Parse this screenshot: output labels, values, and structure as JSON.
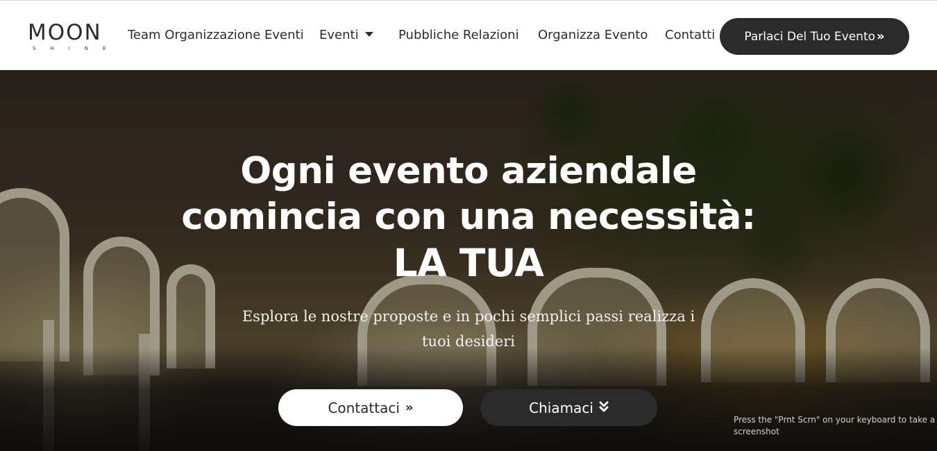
{
  "logo": {
    "main": "MOON",
    "sub": "SHINE"
  },
  "nav": {
    "items": [
      {
        "label": "Team Organizzazione Eventi"
      },
      {
        "label": "Eventi"
      },
      {
        "label": "Pubbliche Relazioni"
      },
      {
        "label": "Organizza Evento"
      },
      {
        "label": "Contatti"
      }
    ],
    "cta_label": "Parlaci Del Tuo Evento",
    "cta_icon": "double-chevron-right-icon"
  },
  "hero": {
    "title_line1": "Ogni evento aziendale",
    "title_line2": "comincia con una necessità:",
    "title_line3": "LA TUA",
    "subtitle": "Esplora le nostre proposte e in pochi semplici passi realizza i tuoi desideri",
    "btn_contact": "Contattaci",
    "btn_contact_icon": "double-chevron-right-icon",
    "btn_call": "Chiamaci",
    "btn_call_icon": "double-chevron-down-icon"
  },
  "toast": {
    "text": "Press the \"Prnt Scrn\" on your keyboard to take a screenshot"
  },
  "colors": {
    "dark_button": "#2b2b2c",
    "header_bg": "#ffffff",
    "text_dark": "#2b2b2b",
    "hero_text": "#ffffff"
  }
}
